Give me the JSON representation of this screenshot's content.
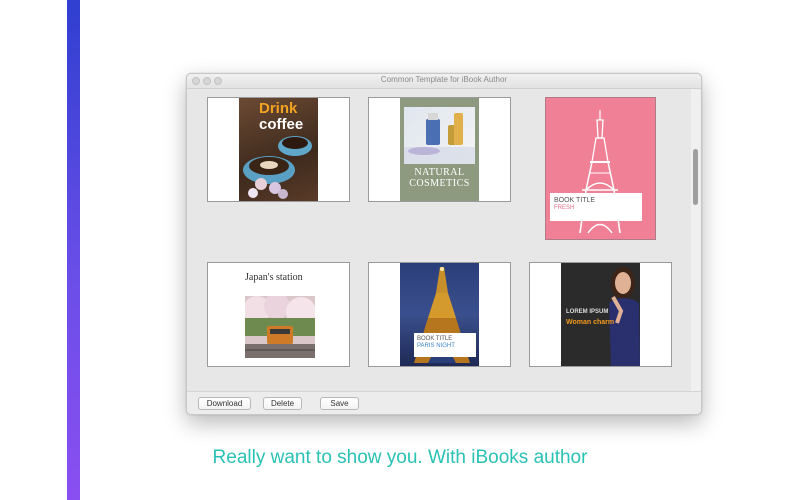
{
  "window": {
    "title": "Common Template for iBook Author"
  },
  "templates": [
    {
      "title_line1": "Drink",
      "title_line2": "coffee"
    },
    {
      "title_line1": "Natural",
      "title_line2": "Cosmetics"
    },
    {
      "title_line1": "BOOK TITLE",
      "title_line2": "FRESH"
    },
    {
      "title_line1": "Japan's station"
    },
    {
      "title_line1": "BOOK TITLE",
      "title_line2": "PARIS NIGHT"
    },
    {
      "title_line1": "LOREM IPSUM",
      "title_line2": "Woman charm"
    }
  ],
  "footer": {
    "download": "Download",
    "delete": "Delete",
    "save": "Save"
  },
  "caption": "Really want to show you. With iBooks author",
  "colors": {
    "accent_caption": "#29c2b4",
    "pink_cover": "#f08096",
    "sidebar_top": "#2f3fd0",
    "sidebar_bottom": "#8a4ff0"
  }
}
